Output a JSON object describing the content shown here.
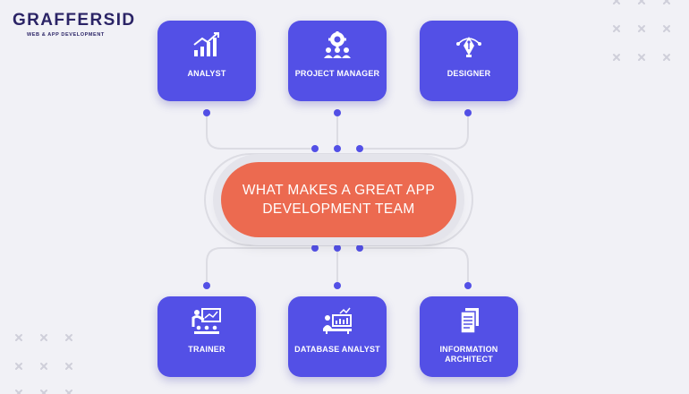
{
  "logo": {
    "name": "GRAFFERSID",
    "tagline": "WEB & APP DEVELOPMENT"
  },
  "center": {
    "title": "WHAT MAKES A GREAT APP DEVELOPMENT TEAM"
  },
  "roles_top": [
    {
      "label": "ANALYST",
      "icon": "growth-chart-icon"
    },
    {
      "label": "PROJECT MANAGER",
      "icon": "team-gear-icon"
    },
    {
      "label": "DESIGNER",
      "icon": "pen-nib-icon"
    }
  ],
  "roles_bottom": [
    {
      "label": "TRAINER",
      "icon": "presentation-board-icon"
    },
    {
      "label": "DATABASE ANALYST",
      "icon": "analyst-desk-icon"
    },
    {
      "label": "INFORMATION ARCHITECT",
      "icon": "document-icon"
    }
  ],
  "colors": {
    "background": "#f1f1f6",
    "card": "#5350e6",
    "center": "#ec6a50",
    "connector": "#dcdce3",
    "dot": "#5350e6",
    "brand": "#2b2466"
  }
}
